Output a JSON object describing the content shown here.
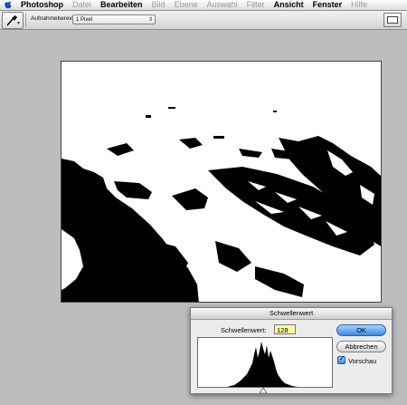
{
  "menubar": {
    "app": "Photoshop",
    "items": [
      "Datei",
      "Bearbeiten",
      "Bild",
      "Ebene",
      "Auswahl",
      "Filter",
      "Ansicht",
      "Fenster",
      "Hilfe"
    ]
  },
  "options_bar": {
    "sample_label": "Aufnahmebereich:",
    "sample_value": "1 Pixel"
  },
  "dialog": {
    "title": "Schwellenwert",
    "threshold_label": "Schwellenwert:",
    "threshold_value": "128",
    "ok_label": "OK",
    "cancel_label": "Abbrechen",
    "preview_label": "Vorschau",
    "preview_checked": true
  },
  "colors": {
    "window_bg": "#bdbdbd",
    "ok_button": "#3c8ae6",
    "threshold_field": "#fff7a8"
  }
}
